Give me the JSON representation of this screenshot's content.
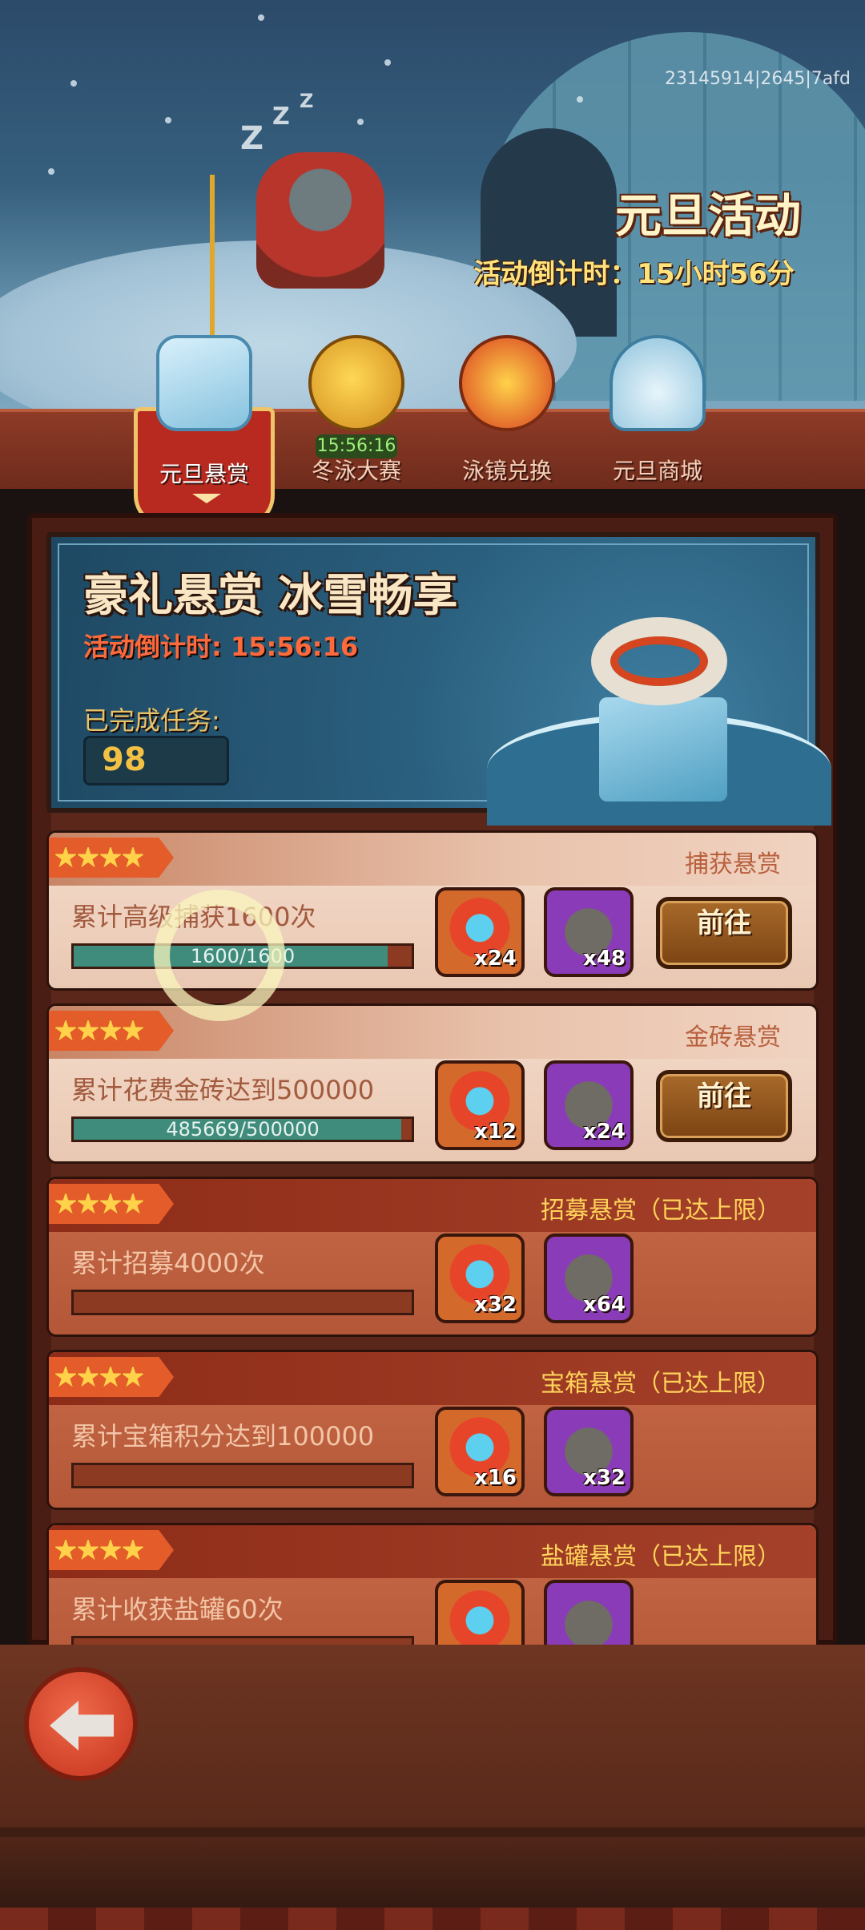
{
  "header": {
    "build_id": "23145914|2645|7afd",
    "event_title": "元旦活动",
    "event_countdown": "活动倒计时：15小时56分"
  },
  "tabs": [
    {
      "label": "元旦悬赏",
      "active": true,
      "icon": "ice-block-icon"
    },
    {
      "label": "冬泳大赛",
      "active": false,
      "icon": "golden-fish-icon",
      "timer": "15:56:16"
    },
    {
      "label": "泳镜兑换",
      "active": false,
      "icon": "goggles-icon"
    },
    {
      "label": "元旦商城",
      "active": false,
      "icon": "igloo-icon"
    }
  ],
  "hero": {
    "title": "豪礼悬赏 冰雪畅享",
    "countdown": "活动倒计时: 15:56:16",
    "completed_label": "已完成任务:",
    "completed_value": "98"
  },
  "tasks": [
    {
      "category": "捕获悬赏",
      "description": "累计高级捕获1600次",
      "progress_text": "1600/1600",
      "progress": 0.93,
      "state": "available",
      "rewards": [
        {
          "icon": "snorkel-mask-icon",
          "qty": "x24"
        },
        {
          "icon": "kettle-icon",
          "qty": "x48"
        }
      ],
      "button": "前往"
    },
    {
      "category": "金砖悬赏",
      "description": "累计花费金砖达到500000",
      "progress_text": "485669/500000",
      "progress": 0.97,
      "state": "available",
      "rewards": [
        {
          "icon": "snorkel-mask-icon",
          "qty": "x12"
        },
        {
          "icon": "kettle-icon",
          "qty": "x24"
        }
      ],
      "button": "前往"
    },
    {
      "category": "招募悬赏（已达上限）",
      "description": "累计招募4000次",
      "progress_text": "",
      "progress": 0,
      "state": "maxed",
      "rewards": [
        {
          "icon": "snorkel-mask-icon",
          "qty": "x32"
        },
        {
          "icon": "kettle-icon",
          "qty": "x64"
        }
      ]
    },
    {
      "category": "宝箱悬赏（已达上限）",
      "description": "累计宝箱积分达到100000",
      "progress_text": "",
      "progress": 0,
      "state": "maxed",
      "rewards": [
        {
          "icon": "snorkel-mask-icon",
          "qty": "x16"
        },
        {
          "icon": "kettle-icon",
          "qty": "x32"
        }
      ]
    },
    {
      "category": "盐罐悬赏（已达上限）",
      "description": "累计收获盐罐60次",
      "progress_text": "",
      "progress": 0,
      "state": "maxed",
      "rewards": [
        {
          "icon": "snorkel-mask-icon",
          "qty": ""
        },
        {
          "icon": "kettle-icon",
          "qty": ""
        }
      ]
    }
  ],
  "back_button": {
    "icon": "back-arrow-icon"
  }
}
